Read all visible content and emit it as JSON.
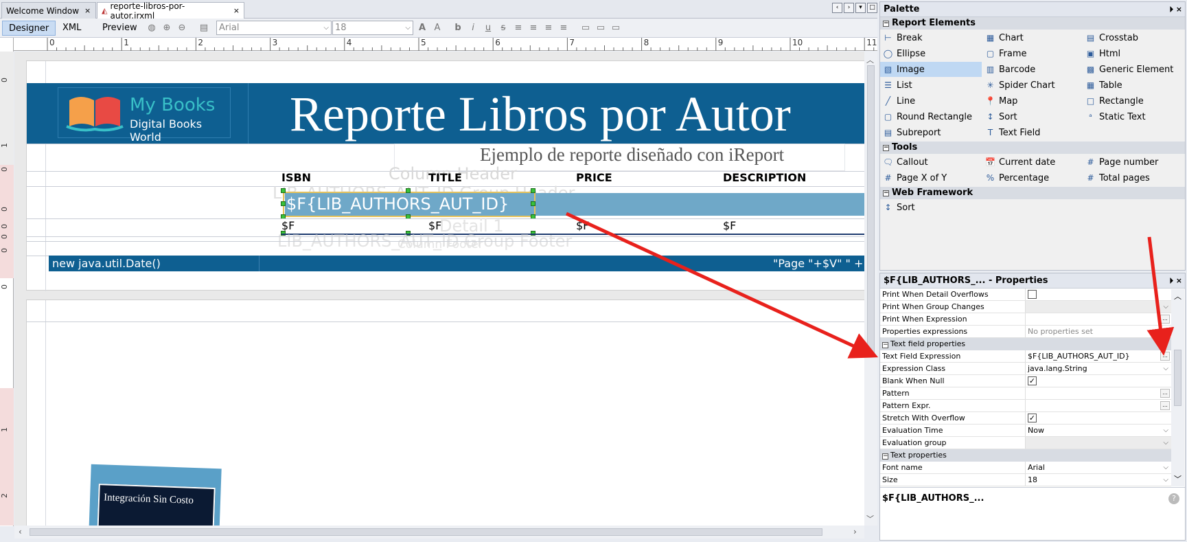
{
  "tabs": [
    {
      "label": "Welcome Window",
      "close": "×"
    },
    {
      "label": "reporte-libros-por-autor.jrxml",
      "close": "×"
    }
  ],
  "modes": [
    "Designer",
    "XML",
    "Preview"
  ],
  "toolbar": {
    "font_name": "Arial",
    "font_size": "18"
  },
  "ruler_h": [
    "0",
    "1",
    "2",
    "3",
    "4",
    "5",
    "6",
    "7",
    "8",
    "9",
    "10",
    "11"
  ],
  "ruler_v": [
    "0",
    "1",
    "0",
    "0",
    "0",
    "0",
    "0",
    "0",
    "1",
    "2"
  ],
  "report": {
    "logo_title": "My Books",
    "logo_subtitle": "Digital Books World",
    "title": "Reporte Libros por Autor",
    "subtitle": "Ejemplo de reporte diseñado con iReport",
    "column_header_ghost": "Column Header",
    "columns": [
      "ISBN",
      "TITLE",
      "PRICE",
      "DESCRIPTION"
    ],
    "group_field": "$F{LIB_AUTHORS_AUT_ID}",
    "group_ghost": "LIB_AUTHORS_AUT_ID Group Header",
    "detail_fields": [
      "$F",
      "$F",
      "$F",
      "$F"
    ],
    "detail_ghost": "Detail 1",
    "group_footer_ghost": "LIB_AUTHORS_AUT_ID Group Footer",
    "column_footer_ghost": "Column Footer",
    "footer_left": "new java.util.Date()",
    "footer_right": "\"Page \"+$V\" \" +",
    "book_cover_text": "Integración Sin Costo"
  },
  "palette": {
    "title": "Palette",
    "categories": [
      {
        "name": "Report Elements",
        "items": [
          {
            "label": "Break",
            "icon": "break-icon"
          },
          {
            "label": "Chart",
            "icon": "chart-icon"
          },
          {
            "label": "Crosstab",
            "icon": "crosstab-icon"
          },
          {
            "label": "Ellipse",
            "icon": "ellipse-icon"
          },
          {
            "label": "Frame",
            "icon": "frame-icon"
          },
          {
            "label": "Html",
            "icon": "html-icon"
          },
          {
            "label": "Image",
            "icon": "image-icon"
          },
          {
            "label": "Barcode",
            "icon": "barcode-icon"
          },
          {
            "label": "Generic Element",
            "icon": "generic-element-icon"
          },
          {
            "label": "List",
            "icon": "list-icon"
          },
          {
            "label": "Spider Chart",
            "icon": "spider-chart-icon"
          },
          {
            "label": "Table",
            "icon": "table-icon"
          },
          {
            "label": "Line",
            "icon": "line-icon"
          },
          {
            "label": "Map",
            "icon": "map-icon"
          },
          {
            "label": "Rectangle",
            "icon": "rectangle-icon"
          },
          {
            "label": "Round Rectangle",
            "icon": "round-rectangle-icon"
          },
          {
            "label": "Sort",
            "icon": "sort-icon"
          },
          {
            "label": "Static Text",
            "icon": "static-text-icon"
          },
          {
            "label": "Subreport",
            "icon": "subreport-icon"
          },
          {
            "label": "Text Field",
            "icon": "text-field-icon"
          }
        ]
      },
      {
        "name": "Tools",
        "items": [
          {
            "label": "Callout",
            "icon": "callout-icon"
          },
          {
            "label": "Current date",
            "icon": "current-date-icon"
          },
          {
            "label": "Page number",
            "icon": "page-number-icon"
          },
          {
            "label": "Page X of Y",
            "icon": "page-x-of-y-icon"
          },
          {
            "label": "Percentage",
            "icon": "percentage-icon"
          },
          {
            "label": "Total pages",
            "icon": "total-pages-icon"
          }
        ]
      },
      {
        "name": "Web Framework",
        "items": [
          {
            "label": "Sort",
            "icon": "sort-icon"
          }
        ]
      }
    ]
  },
  "properties": {
    "title": "$F{LIB_AUTHORS_... - Properties",
    "rows": [
      {
        "name": "Print When Detail Overflows",
        "type": "check",
        "value": ""
      },
      {
        "name": "Print When Group Changes",
        "type": "combo",
        "value": ""
      },
      {
        "name": "Print When Expression",
        "type": "dots",
        "value": ""
      },
      {
        "name": "Properties expressions",
        "type": "text",
        "value": "No properties set"
      },
      {
        "name": "Text field properties",
        "type": "section",
        "value": ""
      },
      {
        "name": "Text Field Expression",
        "type": "dots",
        "value": "$F{LIB_AUTHORS_AUT_ID}"
      },
      {
        "name": "Expression Class",
        "type": "combo",
        "value": "java.lang.String"
      },
      {
        "name": "Blank When Null",
        "type": "check",
        "value": "✓"
      },
      {
        "name": "Pattern",
        "type": "dots",
        "value": ""
      },
      {
        "name": "Pattern Expr.",
        "type": "dots",
        "value": ""
      },
      {
        "name": "Stretch With Overflow",
        "type": "check",
        "value": "✓"
      },
      {
        "name": "Evaluation Time",
        "type": "combo",
        "value": "Now"
      },
      {
        "name": "Evaluation group",
        "type": "combo",
        "value": ""
      },
      {
        "name": "Text properties",
        "type": "section",
        "value": ""
      },
      {
        "name": "Font name",
        "type": "combo",
        "value": "Arial"
      },
      {
        "name": "Size",
        "type": "combo",
        "value": "18"
      }
    ],
    "description": "$F{LIB_AUTHORS_..."
  },
  "colors": {
    "band_blue": "#0e5f91",
    "selected_field": "#6fa8c8",
    "arrow_red": "#e8211c"
  }
}
